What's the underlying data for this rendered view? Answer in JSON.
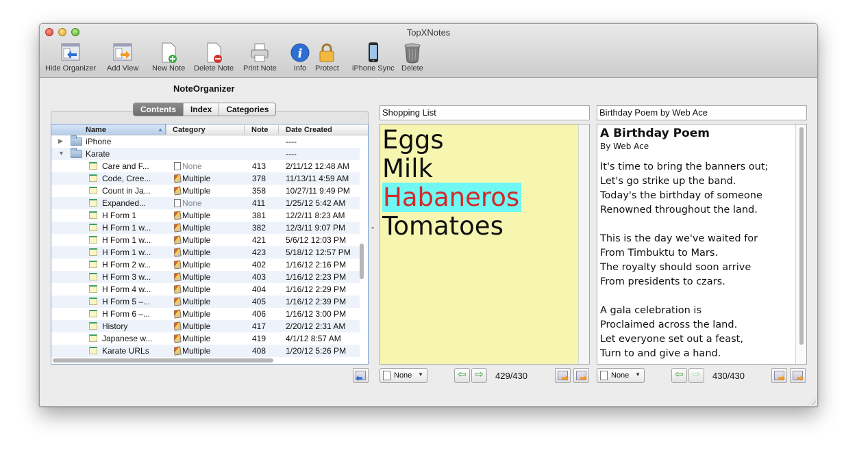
{
  "window": {
    "title": "TopXNotes"
  },
  "toolbar": [
    {
      "label": "Hide Organizer",
      "icon": "hide-organizer-icon"
    },
    {
      "label": "Add View",
      "icon": "add-view-icon"
    },
    {
      "label": "New Note",
      "icon": "new-note-icon"
    },
    {
      "label": "Delete Note",
      "icon": "delete-note-icon"
    },
    {
      "label": "Print Note",
      "icon": "printer-icon"
    },
    {
      "label": "Info",
      "icon": "info-icon"
    },
    {
      "label": "Protect",
      "icon": "lock-icon"
    },
    {
      "label": "iPhone Sync",
      "icon": "iphone-icon"
    },
    {
      "label": "Delete",
      "icon": "trash-icon"
    }
  ],
  "organizer": {
    "title": "NoteOrganizer",
    "tabs": [
      "Contents",
      "Index",
      "Categories"
    ],
    "selected_tab": "Contents",
    "columns": [
      "Name",
      "Category",
      "Note",
      "Date Created"
    ],
    "folders": [
      {
        "name": "iPhone",
        "date": "----",
        "expanded": false
      },
      {
        "name": "Karate",
        "date": "----",
        "expanded": true
      }
    ],
    "rows": [
      {
        "name": "Care and F...",
        "category": "None",
        "note": "413",
        "date": "2/11/12 12:48 AM"
      },
      {
        "name": "Code, Cree...",
        "category": "Multiple",
        "note": "378",
        "date": "11/13/11 4:59 AM"
      },
      {
        "name": "Count in Ja...",
        "category": "Multiple",
        "note": "358",
        "date": "10/27/11 9:49 PM"
      },
      {
        "name": "Expanded...",
        "category": "None",
        "note": "411",
        "date": "1/25/12 5:42 AM"
      },
      {
        "name": "H Form 1",
        "category": "Multiple",
        "note": "381",
        "date": "12/2/11 8:23 AM"
      },
      {
        "name": "H Form 1 w...",
        "category": "Multiple",
        "note": "382",
        "date": "12/3/11 9:07 PM"
      },
      {
        "name": "H Form 1 w...",
        "category": "Multiple",
        "note": "421",
        "date": "5/6/12 12:03 PM"
      },
      {
        "name": "H Form 1 w...",
        "category": "Multiple",
        "note": "423",
        "date": "5/18/12 12:57 PM"
      },
      {
        "name": "H Form 2 w...",
        "category": "Multiple",
        "note": "402",
        "date": "1/16/12 2:16 PM"
      },
      {
        "name": "H Form 3 w...",
        "category": "Multiple",
        "note": "403",
        "date": "1/16/12 2:23 PM"
      },
      {
        "name": "H Form 4 w...",
        "category": "Multiple",
        "note": "404",
        "date": "1/16/12 2:29 PM"
      },
      {
        "name": "H Form 5 –...",
        "category": "Multiple",
        "note": "405",
        "date": "1/16/12 2:39 PM"
      },
      {
        "name": "H Form 6 –...",
        "category": "Multiple",
        "note": "406",
        "date": "1/16/12 3:00 PM"
      },
      {
        "name": "History",
        "category": "Multiple",
        "note": "417",
        "date": "2/20/12 2:31 AM"
      },
      {
        "name": "Japanese w...",
        "category": "Multiple",
        "note": "419",
        "date": "4/1/12 8:57 AM"
      },
      {
        "name": "Karate URLs",
        "category": "Multiple",
        "note": "408",
        "date": "1/20/12 5:26 PM"
      }
    ]
  },
  "note1": {
    "title": "Shopping List",
    "lines": [
      "Eggs",
      "Milk",
      "Habaneros",
      "Tomatoes"
    ],
    "highlighted_line": "Habaneros",
    "background": "#f6f6b1",
    "category": "None",
    "counter": "429/430"
  },
  "note2": {
    "title": "Birthday Poem by Web Ace",
    "heading": "A Birthday Poem",
    "byline": "By Web Ace",
    "stanzas": [
      [
        "It's time to bring the banners out;",
        "Let's go strike up the band.",
        "Today's the birthday of someone",
        "Renowned throughout the land."
      ],
      [
        "This is the day we've waited for",
        "From Timbuktu to Mars.",
        "The royalty should soon arrive",
        "From presidents to czars."
      ],
      [
        "A gala celebration is",
        "Proclaimed across the land.",
        "Let everyone set out a feast,",
        "Turn to and give a hand."
      ]
    ],
    "category": "None",
    "counter": "430/430"
  }
}
